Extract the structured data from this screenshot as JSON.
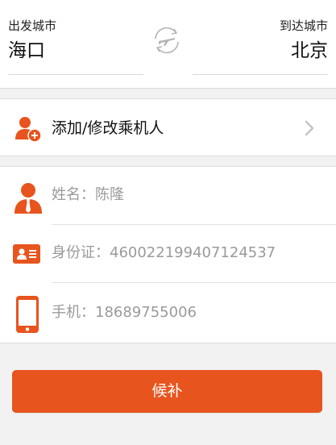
{
  "route": {
    "departure_label": "出发城市",
    "departure_city": "海口",
    "arrival_label": "到达城市",
    "arrival_city": "北京"
  },
  "add_passenger": {
    "label": "添加/修改乘机人"
  },
  "passenger": {
    "name_label": "姓名：",
    "name_value": "陈隆",
    "id_label": "身份证：",
    "id_value": "460022199407124537",
    "phone_label": "手机：",
    "phone_value": "18689755006"
  },
  "submit_label": "候补",
  "colors": {
    "accent": "#e8541e",
    "background": "#f2f2f2",
    "muted_text": "#9a9a9a"
  },
  "icons": [
    "plane-swap-icon",
    "add-passenger-icon",
    "chevron-right-icon",
    "person-icon",
    "id-card-icon",
    "phone-icon"
  ]
}
